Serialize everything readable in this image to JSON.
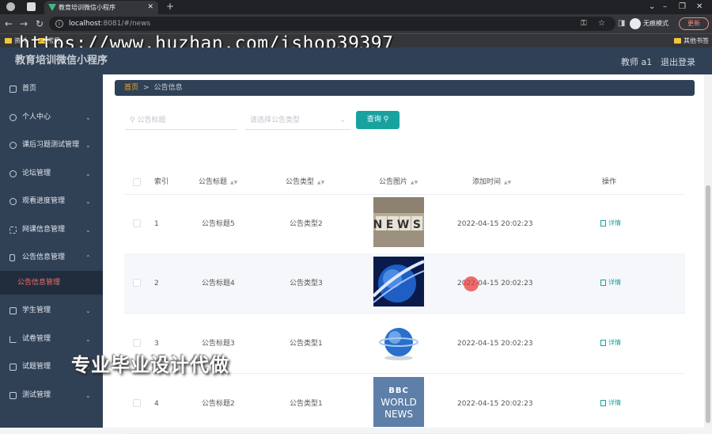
{
  "browser": {
    "tab_title": "教育培训微信小程序",
    "url_host": "localhost",
    "url_rest": ":8081/#/news",
    "incognito_label": "无痕模式",
    "update_label": "更新",
    "bookmarks": [
      "资料",
      "常用"
    ],
    "other_bookmarks": "其他书签"
  },
  "watermark_url": "https://www.huzhan.com/ishop39397",
  "app": {
    "title": "教育培训微信小程序",
    "user": "教师 a1",
    "logout": "退出登录"
  },
  "sidebar": {
    "items": [
      {
        "label": "首页",
        "icon": "home-icon"
      },
      {
        "label": "个人中心",
        "icon": "user-icon"
      },
      {
        "label": "课后习题测试管理",
        "icon": "clock-icon"
      },
      {
        "label": "论坛管理",
        "icon": "power-icon"
      },
      {
        "label": "观看进度管理",
        "icon": "user-icon"
      },
      {
        "label": "网课信息管理",
        "icon": "frame-icon"
      },
      {
        "label": "公告信息管理",
        "icon": "phone-icon"
      },
      {
        "label": "学生管理",
        "icon": "mail-icon"
      },
      {
        "label": "试卷管理",
        "icon": "chart-icon"
      },
      {
        "label": "试题管理",
        "icon": "copy-icon"
      },
      {
        "label": "测试管理",
        "icon": "trash-icon"
      }
    ],
    "active_sub": "公告信息管理"
  },
  "breadcrumb": {
    "home": "首页",
    "sep": ">",
    "current": "公告信息"
  },
  "search": {
    "title_placeholder": "公告标题",
    "type_placeholder": "请选择公告类型",
    "button": "查询"
  },
  "table": {
    "headers": [
      "索引",
      "公告标题",
      "公告类型",
      "公告图片",
      "添加时间",
      "操作"
    ],
    "rows": [
      {
        "index": "1",
        "title": "公告标题5",
        "type": "公告类型2",
        "time": "2022-04-15 20:02:23",
        "action": "详情",
        "image": "news-blocks"
      },
      {
        "index": "2",
        "title": "公告标题4",
        "type": "公告类型3",
        "time": "2022-04-15 20:02:23",
        "action": "详情",
        "image": "blue-globe"
      },
      {
        "index": "3",
        "title": "公告标题3",
        "type": "公告类型1",
        "time": "2022-04-15 20:02:23",
        "action": "详情",
        "image": "news-globe"
      },
      {
        "index": "4",
        "title": "公告标题2",
        "type": "公告类型1",
        "time": "2022-04-15 20:02:23",
        "action": "详情",
        "image": "bbc-world-news"
      }
    ]
  },
  "overlay_text": "专业毕业设计代做",
  "bbc": {
    "line1": "BBC",
    "line2": "WORLD",
    "line3": "NEWS"
  },
  "news_word": "NEWS"
}
